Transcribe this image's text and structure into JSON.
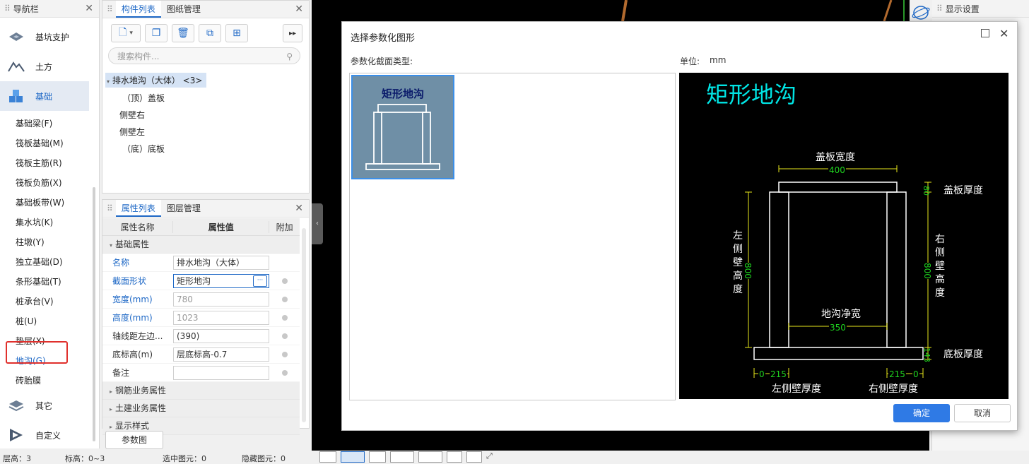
{
  "nav": {
    "title": "导航栏",
    "big_items": [
      {
        "label": "基坑支护",
        "icon": "pit-icon"
      },
      {
        "label": "土方",
        "icon": "earthwork-icon"
      },
      {
        "label": "基础",
        "icon": "foundation-icon"
      }
    ],
    "small_items": [
      "基础梁(F)",
      "筏板基础(M)",
      "筏板主筋(R)",
      "筏板负筋(X)",
      "基础板带(W)",
      "集水坑(K)",
      "柱墩(Y)",
      "独立基础(D)",
      "条形基础(T)",
      "桩承台(V)",
      "桩(U)",
      "垫层(X)",
      "地沟(G)",
      "砖胎膜"
    ],
    "bottom_items": [
      {
        "label": "其它",
        "icon": "layers-icon"
      },
      {
        "label": "自定义",
        "icon": "custom-icon"
      }
    ]
  },
  "component_panel": {
    "tabs": [
      "构件列表",
      "图纸管理"
    ],
    "search_placeholder": "搜索构件...",
    "tree": {
      "root": "排水地沟（大体） <3>",
      "children": [
        "（顶）盖板",
        "侧壁右",
        "侧壁左",
        "（底）底板"
      ]
    }
  },
  "property_panel": {
    "tabs": [
      "属性列表",
      "图层管理"
    ],
    "headers": [
      "属性名称",
      "属性值",
      "附加"
    ],
    "group_basic": "基础属性",
    "rows": [
      {
        "name": "名称",
        "value": "排水地沟（大体）"
      },
      {
        "name": "截面形状",
        "value": "矩形地沟"
      },
      {
        "name": "宽度(mm)",
        "value": "780"
      },
      {
        "name": "高度(mm)",
        "value": "1023"
      },
      {
        "name": "轴线距左边...",
        "value": "(390)"
      },
      {
        "name": "底标高(m)",
        "value": "层底标高-0.7"
      },
      {
        "name": "备注",
        "value": ""
      }
    ],
    "groups": [
      "钢筋业务属性",
      "土建业务属性",
      "显示样式"
    ],
    "param_button": "参数图"
  },
  "right_panel": {
    "title": "显示设置"
  },
  "dialog": {
    "title": "选择参数化图形",
    "type_label": "参数化截面类型:",
    "unit_label": "单位:",
    "unit_value": "mm",
    "thumb_title": "矩形地沟",
    "preview": {
      "title": "矩形地沟",
      "cover_width_label": "盖板宽度",
      "cover_width": "400",
      "cover_thickness": "80",
      "cover_thickness_label": "盖板厚度",
      "left_height_label": [
        "左",
        "侧",
        "壁",
        "高",
        "度"
      ],
      "left_height": "800",
      "right_height_label": [
        "右",
        "侧",
        "壁",
        "高",
        "度"
      ],
      "right_height": "800",
      "clear_width_label": "地沟净宽",
      "clear_width": "350",
      "base_thickness": "143",
      "base_thickness_label": "底板厚度",
      "left_offset": "0",
      "left_wall": "215",
      "right_wall": "215",
      "right_offset": "0",
      "left_wall_label": "左侧壁厚度",
      "right_wall_label": "右侧壁厚度"
    },
    "ok_label": "确定",
    "cancel_label": "取消"
  },
  "status": {
    "items": [
      "层高：3",
      "标高：0~3",
      "选中图元：0",
      "隐藏图元：0"
    ]
  },
  "colors": {
    "accent": "#1e68c6",
    "cad_title": "#00e5e5",
    "cad_dim": "#1fd41f",
    "highlight_red": "#e0302c"
  }
}
